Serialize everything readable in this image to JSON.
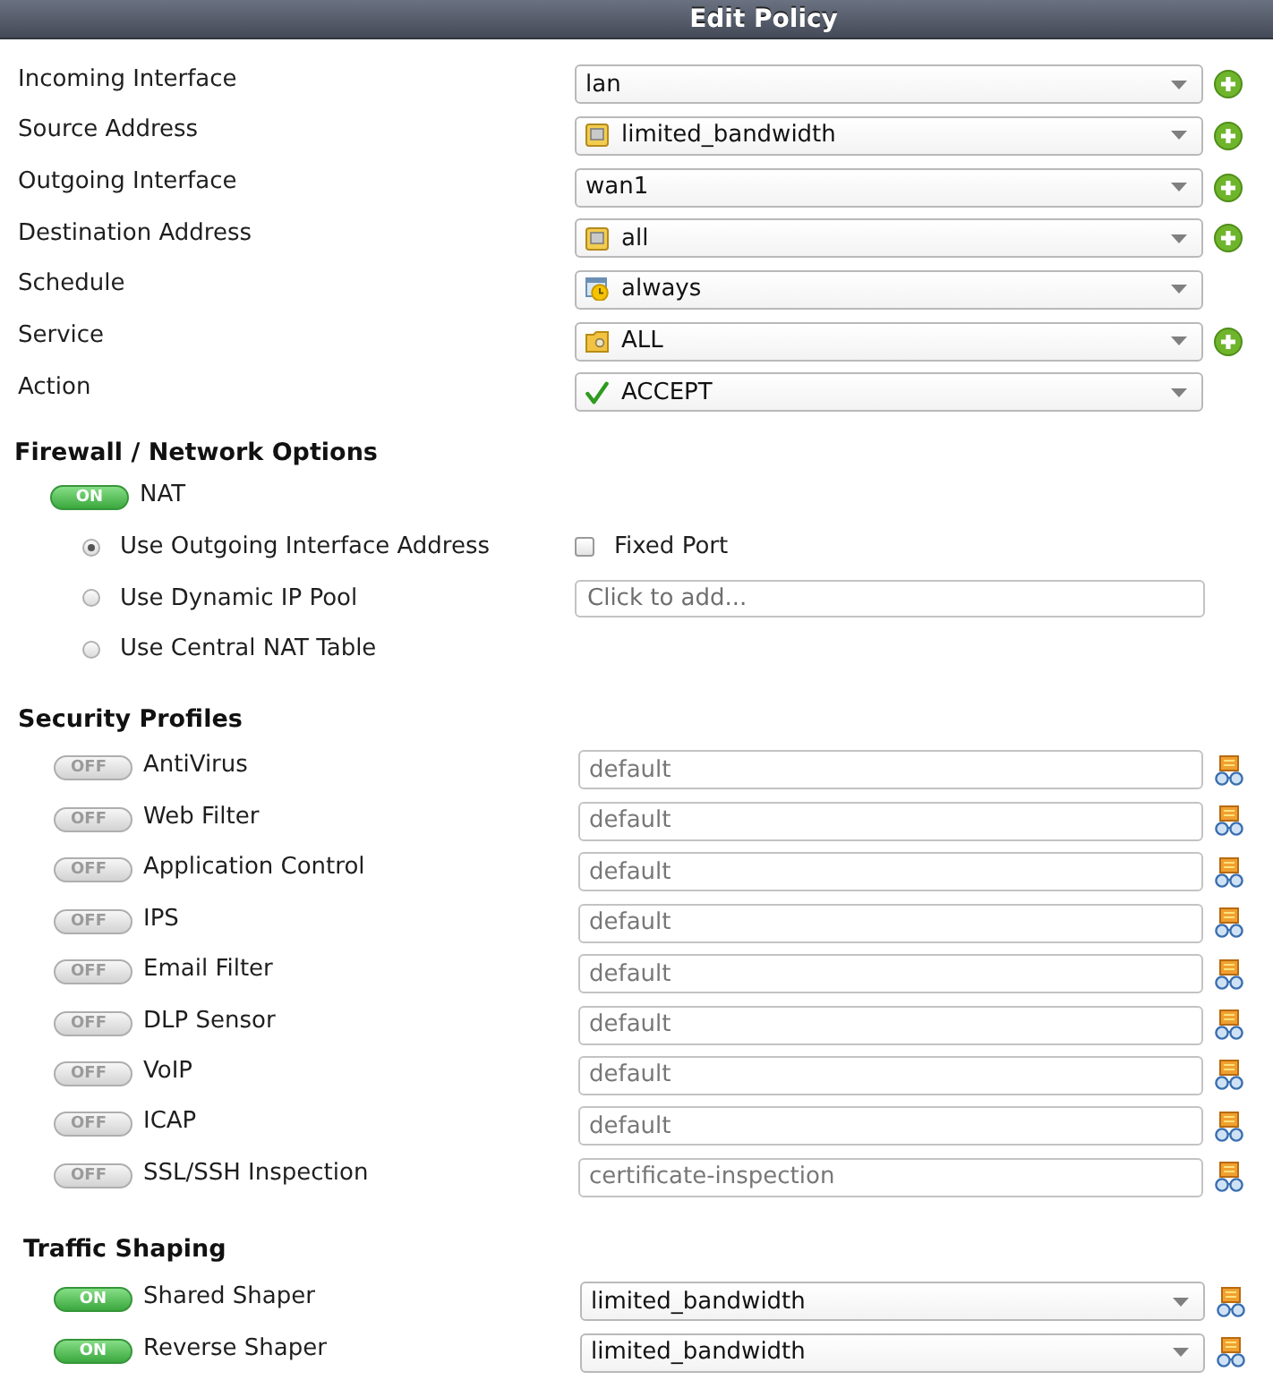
{
  "window": {
    "title": "Edit Policy"
  },
  "policy_fields": [
    {
      "label": "Incoming Interface",
      "value": "lan",
      "kind": "plain",
      "add_button": true
    },
    {
      "label": "Source Address",
      "value": "limited_bandwidth",
      "kind": "address",
      "add_button": true
    },
    {
      "label": "Outgoing Interface",
      "value": "wan1",
      "kind": "plain",
      "add_button": true
    },
    {
      "label": "Destination Address",
      "value": "all",
      "kind": "address",
      "add_button": true
    },
    {
      "label": "Schedule",
      "value": "always",
      "kind": "schedule",
      "add_button": false
    },
    {
      "label": "Service",
      "value": "ALL",
      "kind": "service",
      "add_button": true
    },
    {
      "label": "Action",
      "value": "ACCEPT",
      "kind": "action",
      "add_button": false
    }
  ],
  "firewall_network_options": {
    "heading": "Firewall / Network Options",
    "nat": {
      "label": "NAT",
      "on": true,
      "toggle_text": "ON"
    },
    "nat_options": [
      {
        "label": "Use Outgoing Interface Address",
        "selected": true
      },
      {
        "label": "Use Dynamic IP Pool",
        "selected": false
      },
      {
        "label": "Use Central NAT Table",
        "selected": false
      }
    ],
    "fixed_port": {
      "label": "Fixed Port",
      "checked": false
    },
    "ip_pool": {
      "placeholder": "Click to add..."
    }
  },
  "security_profiles": {
    "heading": "Security Profiles",
    "items": [
      {
        "label": "AntiVirus",
        "on": false,
        "toggle_text": "OFF",
        "value": "default"
      },
      {
        "label": "Web Filter",
        "on": false,
        "toggle_text": "OFF",
        "value": "default"
      },
      {
        "label": "Application Control",
        "on": false,
        "toggle_text": "OFF",
        "value": "default"
      },
      {
        "label": "IPS",
        "on": false,
        "toggle_text": "OFF",
        "value": "default"
      },
      {
        "label": "Email Filter",
        "on": false,
        "toggle_text": "OFF",
        "value": "default"
      },
      {
        "label": "DLP Sensor",
        "on": false,
        "toggle_text": "OFF",
        "value": "default"
      },
      {
        "label": "VoIP",
        "on": false,
        "toggle_text": "OFF",
        "value": "default"
      },
      {
        "label": "ICAP",
        "on": false,
        "toggle_text": "OFF",
        "value": "default"
      },
      {
        "label": "SSL/SSH Inspection",
        "on": false,
        "toggle_text": "OFF",
        "value": "certificate-inspection"
      }
    ]
  },
  "traffic_shaping": {
    "heading": "Traffic Shaping",
    "items": [
      {
        "label": "Shared Shaper",
        "on": true,
        "toggle_text": "ON",
        "value": "limited_bandwidth"
      },
      {
        "label": "Reverse Shaper",
        "on": true,
        "toggle_text": "ON",
        "value": "limited_bandwidth"
      }
    ]
  }
}
